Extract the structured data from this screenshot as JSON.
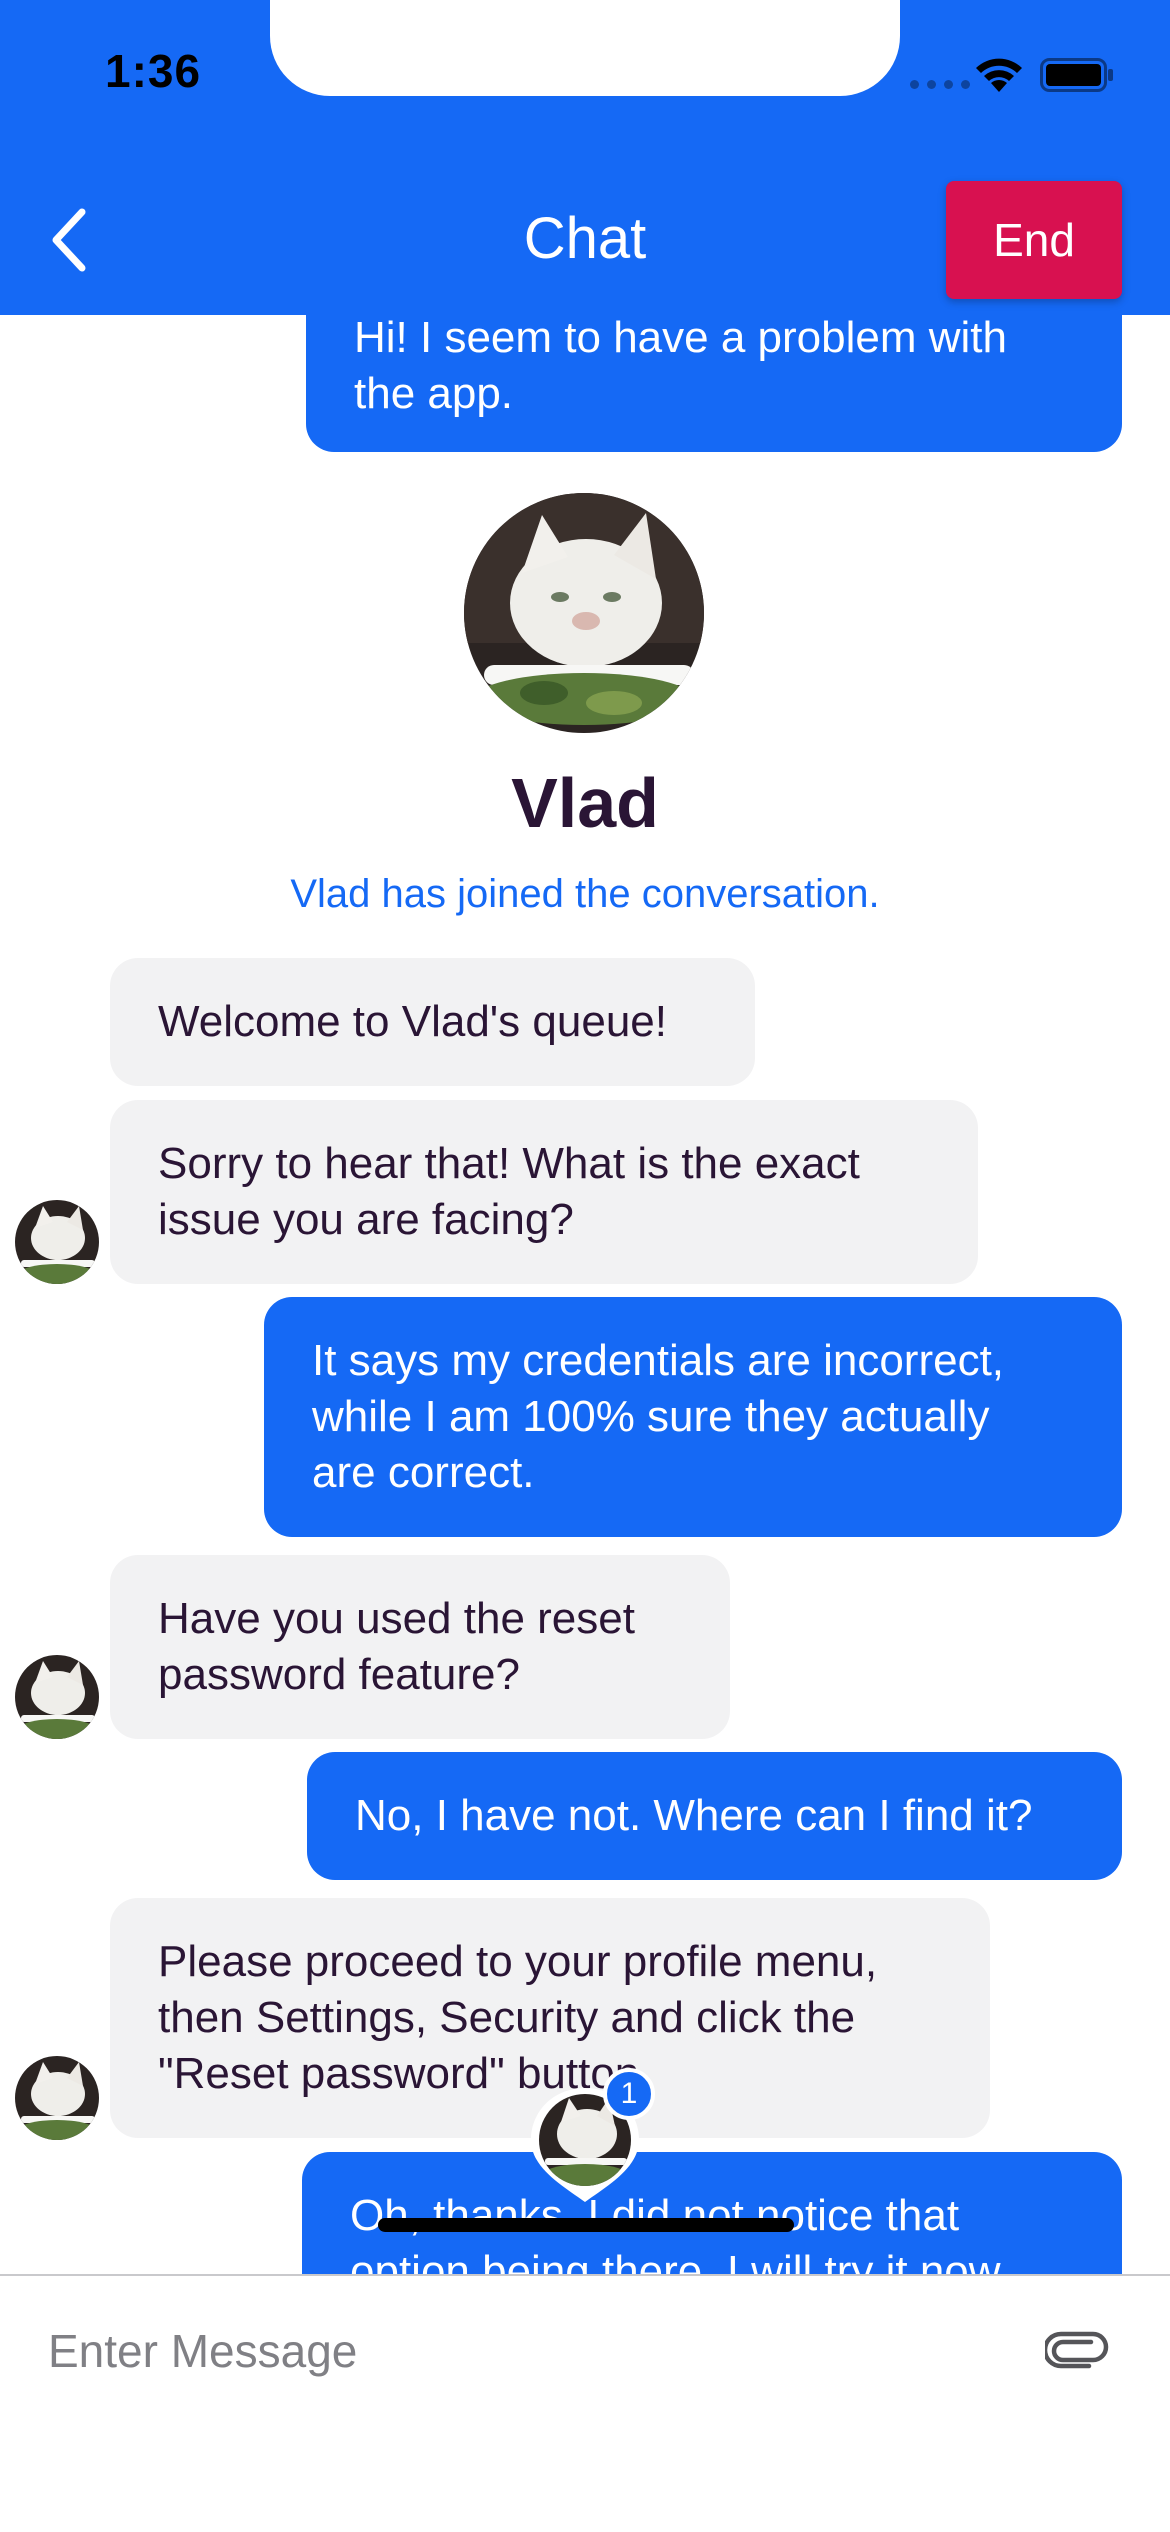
{
  "status_bar": {
    "time": "1:36"
  },
  "header": {
    "title": "Chat",
    "back_icon": "chevron-left-icon",
    "end_label": "End"
  },
  "agent": {
    "name": "Vlad",
    "join_notice": "Vlad has joined the conversation."
  },
  "messages": [
    {
      "sender": "user",
      "text": "Hi! I seem to have a problem with\nthe app."
    },
    {
      "sender": "agent",
      "text": "Welcome to Vlad's queue!"
    },
    {
      "sender": "agent",
      "text": "Sorry to hear that! What is the exact\nissue you are facing?"
    },
    {
      "sender": "user",
      "text": "It says my credentials are incorrect,\nwhile I am 100% sure they actually\nare correct."
    },
    {
      "sender": "agent",
      "text": "Have you used the reset\npassword feature?"
    },
    {
      "sender": "user",
      "text": "No, I have not. Where can I find it?"
    },
    {
      "sender": "agent",
      "text": "Please proceed to your profile menu,\nthen Settings, Security and click the\n\"Reset password\" button"
    },
    {
      "sender": "user",
      "text": "Oh, thanks. I did not notice that\noption being there. I will try it now"
    }
  ],
  "unread_indicator": {
    "count": "1"
  },
  "composer": {
    "placeholder": "Enter Message",
    "attach_icon": "paperclip-icon"
  },
  "colors": {
    "primary": "#1569f5",
    "end_button": "#d81150",
    "incoming_bubble": "#f2f2f3",
    "text_dark": "#2a1535"
  }
}
